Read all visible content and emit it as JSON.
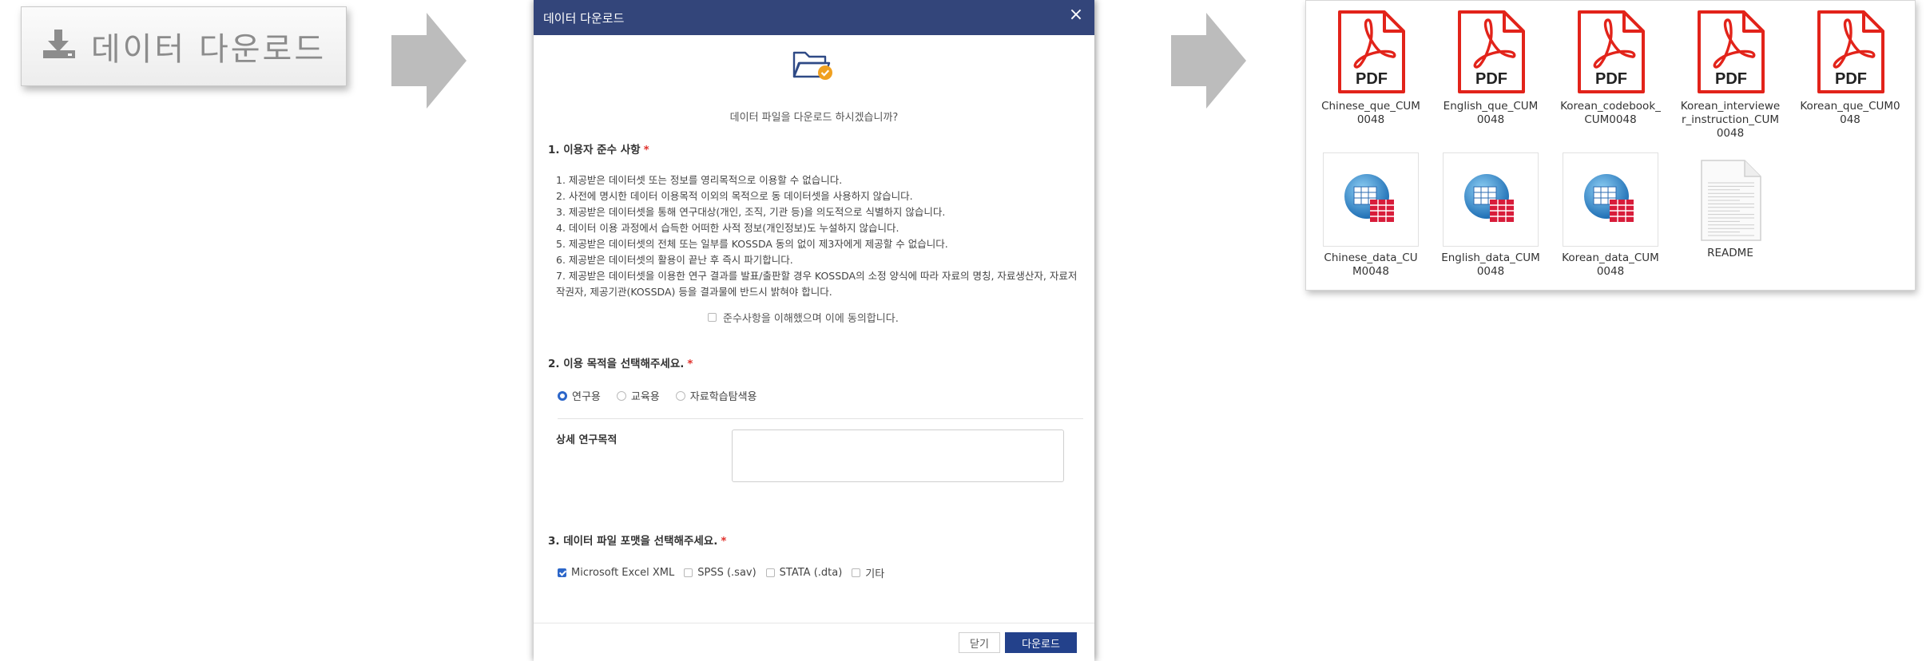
{
  "download_button": {
    "label": "데이터 다운로드",
    "icon": "download-icon"
  },
  "modal": {
    "title": "데이터 다운로드",
    "question": "데이터 파일을 다운로드 하시겠습니까?",
    "section1": {
      "title": "1. 이용자 준수 사항",
      "required_mark": "*",
      "rules": [
        "1. 제공받은 데이터셋 또는 정보를 영리목적으로 이용할 수 없습니다.",
        "2. 사전에 명시한 데이터 이용목적 이외의 목적으로 동 데이터셋을 사용하지 않습니다.",
        "3. 제공받은 데이터셋을 통해 연구대상(개인, 조직, 기관 등)을 의도적으로 식별하지 않습니다.",
        "4. 데이터 이용 과정에서 습득한 어떠한 사적 정보(개인정보)도 누설하지 않습니다.",
        "5. 제공받은 데이터셋의 전체 또는 일부를 KOSSDA 동의 없이 제3자에게 제공할 수 없습니다.",
        "6. 제공받은 데이터셋의 활용이 끝난 후 즉시 파기합니다.",
        "7. 제공받은 데이터셋을 이용한 연구 결과를 발표/출판할 경우 KOSSDA의 소정 양식에 따라 자료의 명칭, 자료생산자, 자료저작권자, 제공기관(KOSSDA) 등을 결과물에 반드시 밝혀야 합니다."
      ],
      "agree_label": "준수사항을 이해했으며 이에 동의합니다."
    },
    "section2": {
      "title": "2. 이용 목적을 선택해주세요.",
      "required_mark": "*",
      "options": [
        "연구용",
        "교육용",
        "자료학습탐색용"
      ],
      "selected": "연구용",
      "detail_label": "상세 연구목적",
      "detail_value": ""
    },
    "section3": {
      "title": "3. 데이터 파일 포맷을 선택해주세요.",
      "required_mark": "*",
      "options": [
        "Microsoft Excel XML",
        "SPSS (.sav)",
        "STATA (.dta)",
        "기타"
      ],
      "checked": [
        "Microsoft Excel XML"
      ]
    },
    "buttons": {
      "close": "닫기",
      "download": "다운로드"
    }
  },
  "explorer": {
    "files": [
      {
        "name": "Chinese_que_CUM0048",
        "type": "pdf",
        "badge": "PDF"
      },
      {
        "name": "English_que_CUM0048",
        "type": "pdf",
        "badge": "PDF"
      },
      {
        "name": "Korean_codebook_CUM0048",
        "type": "pdf",
        "badge": "PDF"
      },
      {
        "name": "Korean_interviewer_instruction_CUM0048",
        "type": "pdf",
        "badge": "PDF"
      },
      {
        "name": "Korean_que_CUM0048",
        "type": "pdf",
        "badge": "PDF"
      },
      {
        "name": "Chinese_data_CUM0048",
        "type": "xls"
      },
      {
        "name": "English_data_CUM0048",
        "type": "xls"
      },
      {
        "name": "Korean_data_CUM0048",
        "type": "xls"
      },
      {
        "name": "README",
        "type": "txt"
      }
    ]
  },
  "colors": {
    "header": "#33457a",
    "accent": "#2c66c9",
    "pdf_red": "#e2231a",
    "arrow": "#bcbcbc"
  }
}
